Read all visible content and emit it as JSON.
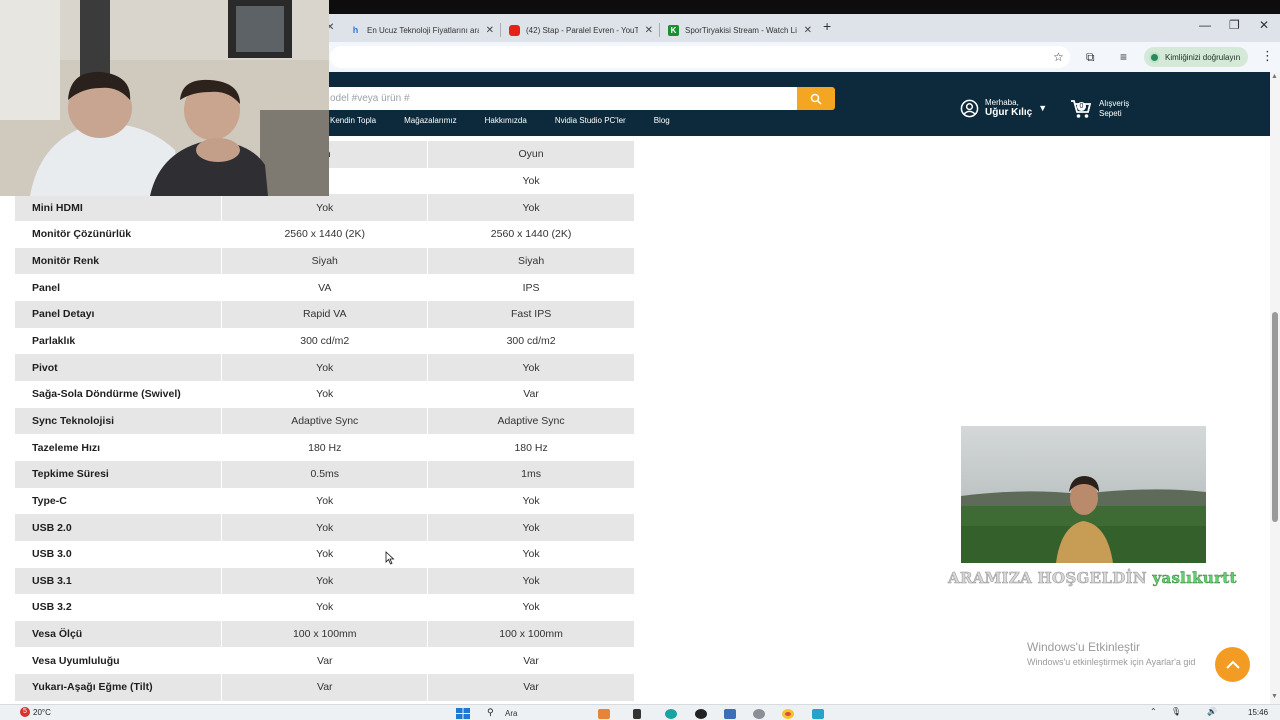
{
  "browser": {
    "tabs": [
      {
        "title": "En Ucuz Teknoloji Fiyatlarını ara",
        "favicon_color": "#2f78d6"
      },
      {
        "title": "(42) Stap - Paralel Evren - YouTu",
        "favicon_color": "#e62117"
      },
      {
        "title": "SporTiryakisi Stream - Watch Li",
        "favicon_color": "#1b8f2e"
      }
    ],
    "profile_label": "Kimliğinizi doğrulayın"
  },
  "site": {
    "search_placeholder": "odel #veya ürün #",
    "nav": [
      "Kendin Topla",
      "Mağazalarımız",
      "Hakkımızda",
      "Nvidia Studio PC'ler",
      "Blog"
    ],
    "user_greeting": "Merhaba,",
    "user_name": "Uğur Kılıç",
    "cart_count": "0",
    "cart_label_1": "Alışveriş",
    "cart_label_2": "Sepeti"
  },
  "specs": [
    {
      "k": "",
      "v1": "un",
      "v2": "Oyun"
    },
    {
      "k": "",
      "v1": "k",
      "v2": "Yok"
    },
    {
      "k": "Mini HDMI",
      "v1": "Yok",
      "v2": "Yok"
    },
    {
      "k": "Monitör Çözünürlük",
      "v1": "2560 x 1440 (2K)",
      "v2": "2560 x 1440 (2K)"
    },
    {
      "k": "Monitör Renk",
      "v1": "Siyah",
      "v2": "Siyah"
    },
    {
      "k": "Panel",
      "v1": "VA",
      "v2": "IPS"
    },
    {
      "k": "Panel Detayı",
      "v1": "Rapid VA",
      "v2": "Fast IPS"
    },
    {
      "k": "Parlaklık",
      "v1": "300 cd/m2",
      "v2": "300 cd/m2"
    },
    {
      "k": "Pivot",
      "v1": "Yok",
      "v2": "Yok"
    },
    {
      "k": "Sağa-Sola Döndürme (Swivel)",
      "v1": "Yok",
      "v2": "Var"
    },
    {
      "k": "Sync Teknolojisi",
      "v1": "Adaptive Sync",
      "v2": "Adaptive Sync"
    },
    {
      "k": "Tazeleme Hızı",
      "v1": "180 Hz",
      "v2": "180 Hz"
    },
    {
      "k": "Tepkime Süresi",
      "v1": "0.5ms",
      "v2": "1ms"
    },
    {
      "k": "Type-C",
      "v1": "Yok",
      "v2": "Yok"
    },
    {
      "k": "USB 2.0",
      "v1": "Yok",
      "v2": "Yok"
    },
    {
      "k": "USB 3.0",
      "v1": "Yok",
      "v2": "Yok"
    },
    {
      "k": "USB 3.1",
      "v1": "Yok",
      "v2": "Yok"
    },
    {
      "k": "USB 3.2",
      "v1": "Yok",
      "v2": "Yok"
    },
    {
      "k": "Vesa Ölçü",
      "v1": "100 x 100mm",
      "v2": "100 x 100mm"
    },
    {
      "k": "Vesa Uyumluluğu",
      "v1": "Var",
      "v2": "Var"
    },
    {
      "k": "Yukarı-Aşağı Eğme (Tilt)",
      "v1": "Var",
      "v2": "Var"
    }
  ],
  "overlay": {
    "welcome_text": "ARAMIZA HOŞGELDİN",
    "welcome_user": "yaslıkurtt"
  },
  "windows_activation": {
    "title": "Windows'u Etkinleştir",
    "subtitle": "Windows'u etkinleştirmek için Ayarlar'a gid"
  },
  "taskbar": {
    "weather": "20°C",
    "notification_count": "5",
    "search_label": "Ara",
    "time": "15:46"
  }
}
